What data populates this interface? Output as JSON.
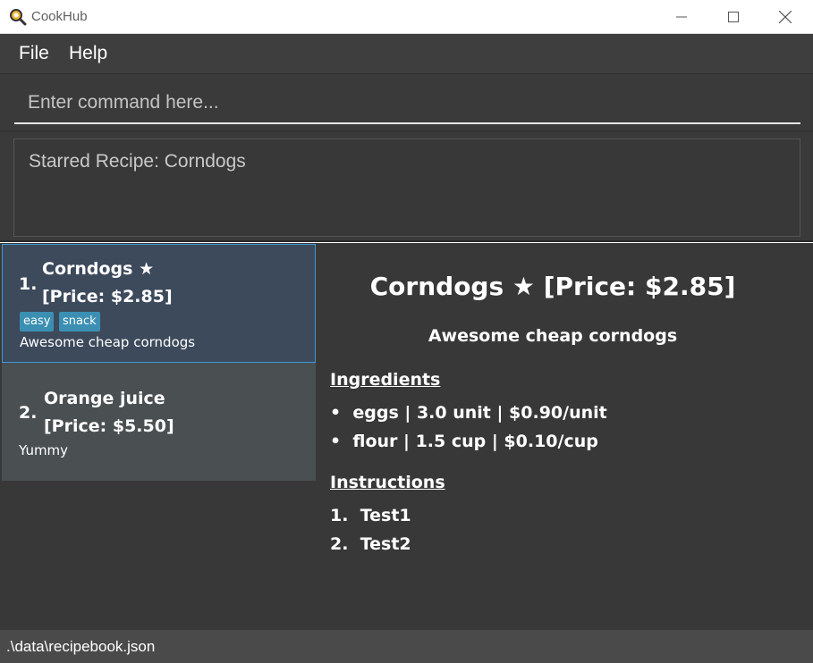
{
  "window": {
    "title": "CookHub"
  },
  "menu": {
    "file_label": "File",
    "help_label": "Help"
  },
  "command": {
    "placeholder": "Enter command here...",
    "value": ""
  },
  "result": {
    "text": "Starred Recipe: Corndogs"
  },
  "recipes": [
    {
      "index": "1.",
      "name": "Corndogs ★",
      "price": "[Price: $2.85]",
      "tags": [
        "easy",
        "snack"
      ],
      "description": "Awesome cheap corndogs",
      "selected": true
    },
    {
      "index": "2.",
      "name": "Orange juice",
      "price": "[Price: $5.50]",
      "tags": [],
      "description": "Yummy",
      "selected": false
    }
  ],
  "detail": {
    "title": "Corndogs ★ [Price: $2.85]",
    "description": "Awesome cheap corndogs",
    "ingredients_heading": "Ingredients",
    "ingredients": [
      "eggs | 3.0 unit | $0.90/unit",
      "flour | 1.5 cup | $0.10/cup"
    ],
    "instructions_heading": "Instructions",
    "instructions": [
      {
        "num": "1.",
        "text": "Test1"
      },
      {
        "num": "2.",
        "text": "Test2"
      }
    ]
  },
  "status": {
    "file_path": ".\\data\\recipebook.json"
  },
  "colors": {
    "menubar": "#3e3e3e",
    "panel": "#383838",
    "selected_card": "#3d4a5c",
    "selected_border": "#3c9ad6",
    "card": "#4a5052",
    "tag": "#3b8fb3",
    "statusbar": "#4a4a4a"
  },
  "icons": {
    "app": "magnifier-pan-icon",
    "minimize": "minimize-icon",
    "maximize": "maximize-icon",
    "close": "close-icon"
  }
}
